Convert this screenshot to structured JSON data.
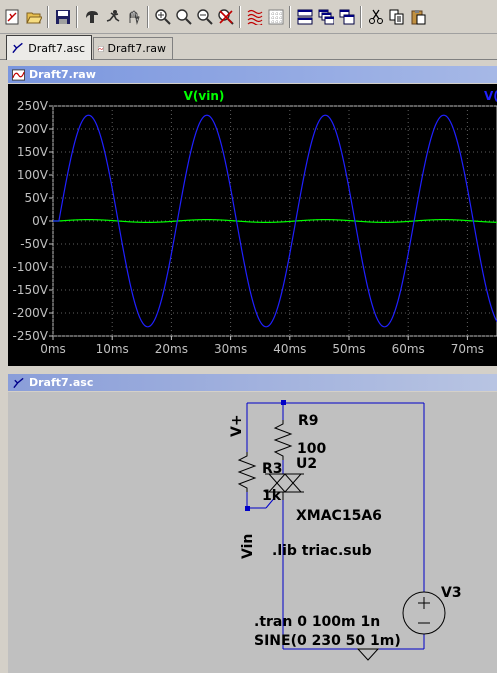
{
  "toolbar": {
    "buttons": [
      {
        "name": "new-schematic-icon"
      },
      {
        "name": "open-icon"
      },
      {
        "sep": true
      },
      {
        "name": "save-icon"
      },
      {
        "sep": true
      },
      {
        "name": "control-panel-icon"
      },
      {
        "name": "run-icon"
      },
      {
        "name": "halt-icon"
      },
      {
        "sep": true
      },
      {
        "name": "zoom-in-icon"
      },
      {
        "name": "zoom-area-icon"
      },
      {
        "name": "zoom-out-icon"
      },
      {
        "name": "zoom-cancel-icon"
      },
      {
        "sep": true
      },
      {
        "name": "autorange-icon"
      },
      {
        "name": "grid-icon"
      },
      {
        "sep": true
      },
      {
        "name": "tile-horizontal-icon"
      },
      {
        "name": "cascade-icon"
      },
      {
        "name": "tile-vertical-icon"
      },
      {
        "sep": true
      },
      {
        "name": "cut-icon"
      },
      {
        "name": "copy-icon"
      },
      {
        "name": "paste-icon"
      }
    ]
  },
  "tabs": [
    {
      "label": "Draft7.asc",
      "active": true
    },
    {
      "label": "Draft7.raw",
      "active": false
    }
  ],
  "plot_window": {
    "title": "Draft7.raw"
  },
  "schematic_window": {
    "title": "Draft7.asc"
  },
  "chart_data": {
    "type": "line",
    "series": [
      {
        "name": "V(vin)",
        "color": "#00ff00",
        "amplitude": 3,
        "frequency": 50,
        "delay_ms": 1
      },
      {
        "name": "V(",
        "color": "#2020ff",
        "amplitude": 230,
        "frequency": 50,
        "delay_ms": 1
      }
    ],
    "xlim": [
      0,
      75
    ],
    "xticks": [
      "0ms",
      "10ms",
      "20ms",
      "30ms",
      "40ms",
      "50ms",
      "60ms",
      "70ms"
    ],
    "ylim": [
      -250,
      250
    ],
    "yticks": [
      "250V",
      "200V",
      "150V",
      "100V",
      "50V",
      "0V",
      "-50V",
      "-100V",
      "-150V",
      "-200V",
      "-250V"
    ],
    "grid": true
  },
  "schematic": {
    "labels": {
      "vplus": "V+",
      "vin": "Vin",
      "r9_name": "R9",
      "r9_value": "100",
      "r3_name": "R3",
      "r3_value": "1k",
      "u2_name": "U2",
      "u2_value": "XMAC15A6",
      "lib": ".lib triac.sub",
      "v3_name": "V3",
      "tran": ".tran 0 100m 1n",
      "sine": "SINE(0 230 50 1m)"
    }
  }
}
